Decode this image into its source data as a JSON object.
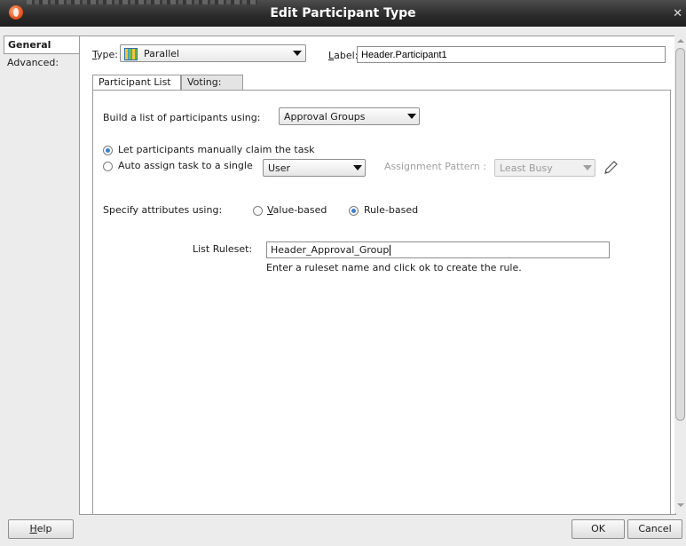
{
  "window": {
    "title": "Edit Participant Type"
  },
  "side_tabs": [
    {
      "label": "General",
      "active": true
    },
    {
      "label": "Advanced:",
      "active": false
    }
  ],
  "type_row": {
    "label": "Type:",
    "value": "Parallel",
    "icon": "parallel-grid-icon"
  },
  "label_row": {
    "label": "Label:",
    "value": "Header.Participant1"
  },
  "inner_tabs": [
    {
      "label": "Participant List",
      "active": true
    },
    {
      "label": "Voting:",
      "active": false
    }
  ],
  "participant_list": {
    "build_label": "Build a list of participants using:",
    "build_value": "Approval Groups",
    "claim_option": "Let participants manually claim the task",
    "auto_option": "Auto assign task to a single",
    "auto_value": "User",
    "assignment_pattern_label": "Assignment Pattern :",
    "assignment_pattern_value": "Least Busy",
    "attributes_label": "Specify attributes using:",
    "value_based": "Value-based",
    "rule_based": "Rule-based",
    "ruleset_label": "List Ruleset:",
    "ruleset_value": "Header_Approval_Group",
    "ruleset_hint": "Enter a ruleset name and click ok to create the rule."
  },
  "buttons": {
    "help": "Help",
    "ok": "OK",
    "cancel": "Cancel"
  }
}
